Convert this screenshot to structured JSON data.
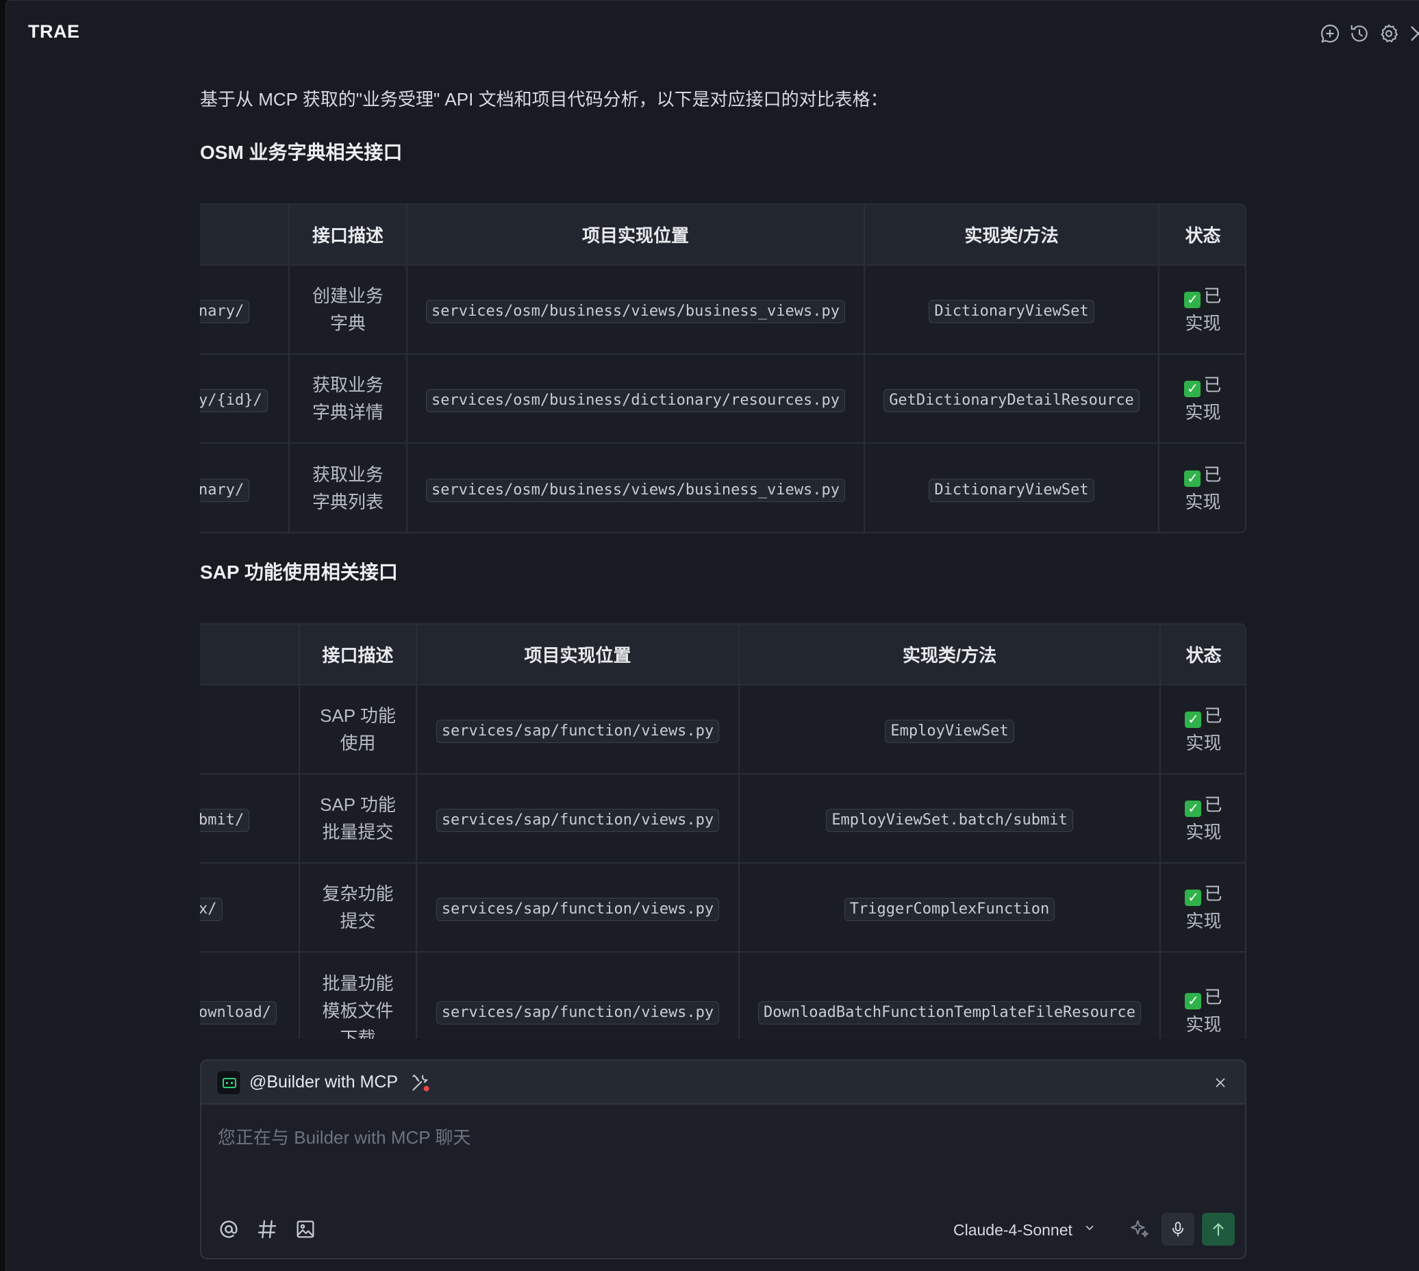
{
  "app": {
    "title": "TRAE"
  },
  "titlebar_icons": [
    "new-chat-icon",
    "history-icon",
    "settings-icon",
    "close-icon"
  ],
  "message": {
    "intro": "基于从 MCP 获取的\"业务受理\" API 文档和项目代码分析，以下是对应接口的对比表格：",
    "sections": [
      {
        "heading": "OSM 业务字典相关接口",
        "columns": [
          "接口描述",
          "项目实现位置",
          "实现类/方法",
          "状态"
        ],
        "rows": [
          {
            "url": "nary/",
            "desc": "创建业务字典",
            "location": "services/osm/business/views/business_views.py",
            "impl": "DictionaryViewSet",
            "status": "已实现"
          },
          {
            "url": "y/{id}/",
            "desc": "获取业务字典详情",
            "location": "services/osm/business/dictionary/resources.py",
            "impl": "GetDictionaryDetailResource",
            "status": "已实现"
          },
          {
            "url": "nary/",
            "desc": "获取业务字典列表",
            "location": "services/osm/business/views/business_views.py",
            "impl": "DictionaryViewSet",
            "status": "已实现"
          }
        ]
      },
      {
        "heading": "SAP 功能使用相关接口",
        "columns": [
          "接口描述",
          "项目实现位置",
          "实现类/方法",
          "状态"
        ],
        "rows": [
          {
            "url": "",
            "desc": "SAP 功能使用",
            "location": "services/sap/function/views.py",
            "impl": "EmployViewSet",
            "status": "已实现"
          },
          {
            "url": "bmit/",
            "desc": "SAP 功能批量提交",
            "location": "services/sap/function/views.py",
            "impl": "EmployViewSet.batch/submit",
            "status": "已实现"
          },
          {
            "url": "x/",
            "desc": "复杂功能提交",
            "location": "services/sap/function/views.py",
            "impl": "TriggerComplexFunction",
            "status": "已实现"
          },
          {
            "url": "ownload/",
            "desc": "批量功能模板文件下载",
            "location": "services/sap/function/views.py",
            "impl": "DownloadBatchFunctionTemplateFileResource",
            "status": "已实现"
          }
        ]
      }
    ]
  },
  "composer": {
    "agent_name": "@Builder with MCP",
    "placeholder": "您正在与 Builder with MCP 聊天",
    "value": "",
    "model": "Claude-4-Sonnet",
    "tool_icons": [
      "mention-icon",
      "hashtag-icon",
      "image-icon"
    ]
  },
  "colors": {
    "background": "#181b22",
    "table_header": "#22262e",
    "status_check": "#2fb24a",
    "send_button": "#1f5a3e",
    "agent_icon_accent": "#2fd07a"
  }
}
